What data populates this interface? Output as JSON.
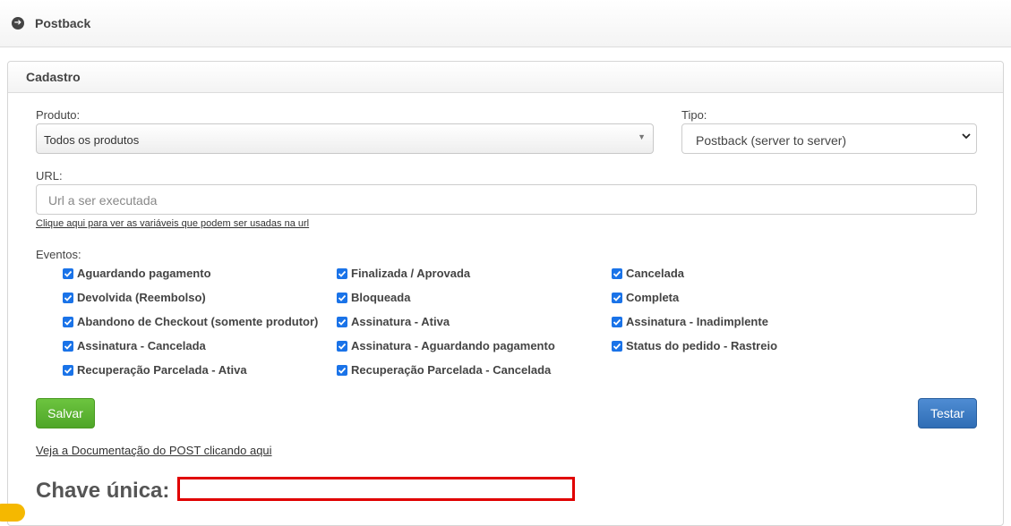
{
  "header": {
    "title": "Postback",
    "icon": "arrow-circle-right-icon"
  },
  "panel": {
    "title": "Cadastro"
  },
  "form": {
    "produto_label": "Produto:",
    "produto_value": "Todos os produtos",
    "tipo_label": "Tipo:",
    "tipo_value": "Postback (server to server)",
    "url_label": "URL:",
    "url_placeholder": "Url a ser executada",
    "url_help_link": "Clique aqui para ver as variáveis que podem ser usadas na url",
    "eventos_label": "Eventos:"
  },
  "events": [
    {
      "label": "Aguardando pagamento",
      "checked": true
    },
    {
      "label": "Finalizada / Aprovada",
      "checked": true
    },
    {
      "label": "Cancelada",
      "checked": true
    },
    {
      "label": "Devolvida (Reembolso)",
      "checked": true
    },
    {
      "label": "Bloqueada",
      "checked": true
    },
    {
      "label": "Completa",
      "checked": true
    },
    {
      "label": "Abandono de Checkout (somente produtor)",
      "checked": true
    },
    {
      "label": "Assinatura - Ativa",
      "checked": true
    },
    {
      "label": "Assinatura - Inadimplente",
      "checked": true
    },
    {
      "label": "Assinatura - Cancelada",
      "checked": true
    },
    {
      "label": "Assinatura - Aguardando pagamento",
      "checked": true
    },
    {
      "label": "Status do pedido - Rastreio",
      "checked": true
    },
    {
      "label": "Recuperação Parcelada - Ativa",
      "checked": true
    },
    {
      "label": "Recuperação Parcelada - Cancelada",
      "checked": true
    }
  ],
  "buttons": {
    "save": "Salvar",
    "test": "Testar"
  },
  "doc_link": "Veja a Documentação do POST clicando aqui",
  "chave_label": "Chave única:",
  "colors": {
    "save": "#5cb531",
    "test": "#3d7cc4",
    "checkbox": "#1a73e8",
    "highlight": "#e00000"
  }
}
